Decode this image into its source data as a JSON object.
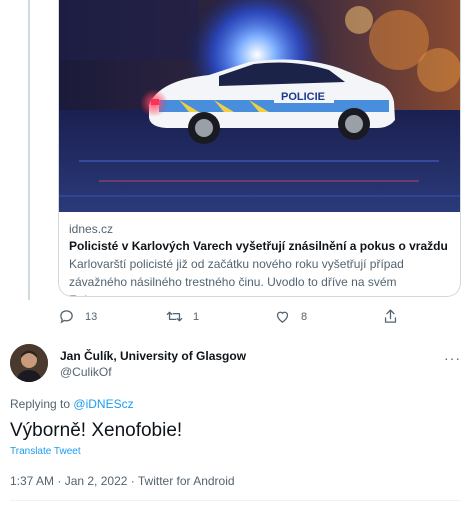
{
  "quoted_card": {
    "domain": "idnes.cz",
    "title": "Policisté v Karlových Varech vyšetřují znásilnění a pokus o vraždu",
    "description": "Karlovarští policisté již od začátku nového roku vyšetřují případ závažného násilného trestného činu. Uvodlo to dříve na svém Twitteru...",
    "image_label": "POLICIE",
    "image_icon": "police-car-photo"
  },
  "actions": {
    "reply_count": "13",
    "retweet_count": "1",
    "like_count": "8"
  },
  "author": {
    "name": "Jan Čulík, University of Glasgow",
    "handle": "@CulikOf"
  },
  "reply": {
    "prefix": "Replying to",
    "mention": "@iDNEScz"
  },
  "tweet": {
    "text": "Výborně! Xenofobie!",
    "translate_label": "Translate Tweet",
    "meta": "1:37 AM · Jan 2, 2022 · Twitter for Android"
  },
  "colors": {
    "link": "#1d9bf0",
    "secondary": "#536471",
    "border": "#cfd9de"
  }
}
